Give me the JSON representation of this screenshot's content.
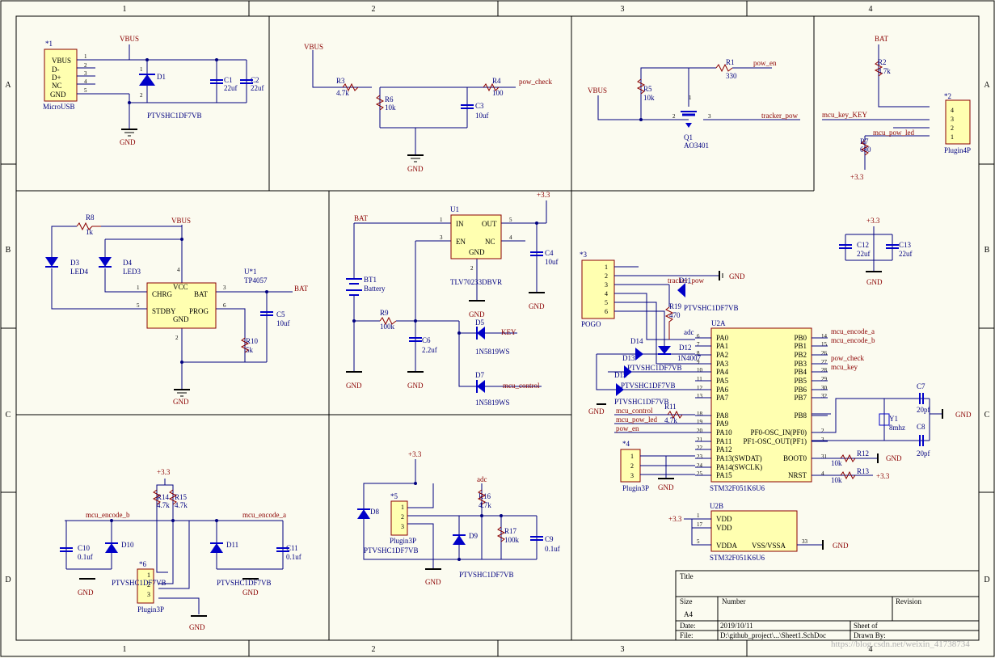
{
  "colors": {
    "bg": "#fbfbf0",
    "wire": "#000080",
    "comp": "#0000c8",
    "body": "#ffffb0",
    "net": "#8b0000",
    "black": "#000000"
  },
  "frame": {
    "cols": [
      "1",
      "2",
      "3",
      "4"
    ],
    "rows": [
      "A",
      "B",
      "C",
      "D"
    ]
  },
  "title_block": {
    "title_label": "Title",
    "size_label": "Size",
    "size_value": "A4",
    "number_label": "Number",
    "revision_label": "Revision",
    "date_label": "Date:",
    "date_value": "2019/10/11",
    "sheet_label": "Sheet    of",
    "file_label": "File:",
    "file_value": "D:\\github_project\\...\\Sheet1.SchDoc",
    "drawn_label": "Drawn By:",
    "watermark": "https://blog.csdn.net/weixin_41738734"
  },
  "usb": {
    "ref": "*1",
    "name": "MicroUSB",
    "pins": [
      "VBUS",
      "D-",
      "D+",
      "NC",
      "GND"
    ],
    "pin_nums": [
      "1",
      "2",
      "3",
      "4",
      "5"
    ],
    "vbus": "VBUS",
    "gnd": "GND",
    "d1": "D1",
    "d1_part": "PTVSHC1DF7VB",
    "c1": "C1",
    "c1v": "22uf",
    "c2": "C2",
    "c2v": "22uf",
    "pin1": "1",
    "pin2": "2"
  },
  "divider": {
    "vbus": "VBUS",
    "r3": "R3",
    "r3v": "4.7k",
    "r6": "R6",
    "r6v": "10k",
    "r4": "R4",
    "r4v": "100",
    "net": "pow_check",
    "c3": "C3",
    "c3v": "10uf",
    "gnd": "GND"
  },
  "mosfet": {
    "r1": "R1",
    "r1v": "330",
    "net_en": "pow_en",
    "vbus": "VBUS",
    "r5": "R5",
    "r5v": "10k",
    "q1": "Q1",
    "q1_part": "AO3401",
    "net_out": "tracker_pow",
    "p1": "1",
    "p2": "2",
    "p3": "3"
  },
  "plugin4": {
    "ref": "*2",
    "name": "Plugin4P",
    "bat": "BAT",
    "r2": "R2",
    "r2v": "4.7k",
    "r7": "R7",
    "r7v": "680",
    "net_key": "mcu_key_KEY",
    "net_led": "mcu_pow_led",
    "p33": "+3.3",
    "pins": [
      "4",
      "3",
      "2",
      "1"
    ]
  },
  "charger": {
    "r8": "R8",
    "r8v": "1k",
    "vbus": "VBUS",
    "d3": "D3",
    "d3n": "LED4",
    "d4": "D4",
    "d4n": "LED3",
    "u1": "U*1",
    "u1_part": "TP4057",
    "pin_vcc": "VCC",
    "pin_chrg": "CHRG",
    "pin_bat": "BAT",
    "pin_stdby": "STDBY",
    "pin_prog": "PROG",
    "pin_gnd": "GND",
    "bat": "BAT",
    "c5": "C5",
    "c5v": "10uf",
    "r10": "R10",
    "r10v": "5k",
    "gnd": "GND",
    "n1": "1",
    "n2": "2",
    "n3": "3",
    "n4": "4",
    "n5": "5",
    "n6": "6"
  },
  "ldo": {
    "bat": "BAT",
    "u1": "U1",
    "part": "TLV70233DBVR",
    "pin_in": "IN",
    "pin_out": "OUT",
    "pin_en": "EN",
    "pin_nc": "NC",
    "pin_gnd": "GND",
    "p33": "+3.3",
    "c4": "C4",
    "c4v": "10uf",
    "bt1": "BT1",
    "bt1n": "Battery",
    "r9": "R9",
    "r9v": "100k",
    "c6": "C6",
    "c6v": "2.2uf",
    "d5": "D5",
    "d5p": "1N5819WS",
    "d7": "D7",
    "d7p": "1N5819WS",
    "net_key": "KEY",
    "net_ctrl": "mcu_control",
    "gnd": "GND",
    "n1": "1",
    "n2": "2",
    "n3": "3",
    "n4": "4",
    "n5": "5"
  },
  "pogo": {
    "ref": "*3",
    "name": "POGO",
    "pins": [
      "1",
      "2",
      "3",
      "4",
      "5",
      "6"
    ],
    "net_tracker": "tracker_pow",
    "d11": "D11",
    "d11p": "PTVSHC1DF7VB",
    "gnd": "GND",
    "r19": "R19",
    "r19v": "470",
    "d12": "D12",
    "d12p": "1N4007",
    "d14": "D14",
    "d13": "D13",
    "d15": "D15",
    "d1x": "PTVSHC1DF7VB"
  },
  "mcu": {
    "ref": "U2A",
    "part": "STM32F051K6U6",
    "left_pins": [
      "PA0",
      "PA1",
      "PA2",
      "PA3",
      "PA4",
      "PA5",
      "PA6",
      "PA7",
      "PA8",
      "PA9",
      "PA10",
      "PA11",
      "PA12",
      "PA13(SWDAT)",
      "PA14(SWCLK)",
      "PA15"
    ],
    "left_nums": [
      "6",
      "7",
      "8",
      "9",
      "10",
      "11",
      "12",
      "13",
      "18",
      "19",
      "20",
      "21",
      "22",
      "23",
      "24",
      "25"
    ],
    "right_pins": [
      "PB0",
      "PB1",
      "PB2",
      "PB3",
      "PB4",
      "PB5",
      "PB6",
      "PB7",
      "PB8",
      "PF0-OSC_IN(PF0)",
      "PF1-OSC_OUT(PF1)",
      "BOOT0",
      "NRST"
    ],
    "right_nums": [
      "14",
      "15",
      "26",
      "27",
      "28",
      "29",
      "30",
      "32",
      "",
      "2",
      "3",
      "31",
      "4"
    ],
    "net_adc": "adc",
    "net_ctrl": "mcu_control",
    "net_led": "mcu_pow_led",
    "net_en": "pow_en",
    "net_enc_a": "mcu_encode_a",
    "net_enc_b": "mcu_encode_b",
    "net_check": "pow_check",
    "net_key": "mcu_key",
    "r11": "R11",
    "r11v": "4.7k",
    "y1": "Y1",
    "y1v": "8mhz",
    "c7": "C7",
    "c7v": "20pf",
    "c8": "C8",
    "c8v": "20pf",
    "r12": "R12",
    "r12v": "10k",
    "r13": "R13",
    "r13v": "10k",
    "p33": "+3.3",
    "gnd": "GND"
  },
  "plugin3_mid": {
    "ref": "*4",
    "name": "Plugin3P",
    "gnd": "GND",
    "pins": [
      "1",
      "2",
      "3"
    ]
  },
  "mcu_b": {
    "ref": "U2B",
    "part": "STM32F051K6U6",
    "vdd": "VDD",
    "vdda": "VDDA",
    "vss": "VSS/VSSA",
    "p33": "+3.3",
    "gnd": "GND",
    "n1": "1",
    "n17": "17",
    "n5": "5",
    "n33": "33"
  },
  "caps_b": {
    "p33": "+3.3",
    "c12": "C12",
    "c12v": "22uf",
    "c13": "C13",
    "c13v": "22uf",
    "gnd": "GND"
  },
  "encoder": {
    "p33": "+3.3",
    "r14": "R14",
    "r14v": "4.7k",
    "r15": "R15",
    "r15v": "4.7k",
    "net_b": "mcu_encode_b",
    "net_a": "mcu_encode_a",
    "c10": "C10",
    "c10v": "0.1uf",
    "c11": "C11",
    "c11v": "0.1uf",
    "d10": "D10",
    "d10p": "PTVSHC1DF7VB",
    "d11": "D11",
    "d11p": "PTVSHC1DF7VB",
    "ref": "*6",
    "name": "Plugin3P",
    "gnd": "GND",
    "pins": [
      "1",
      "2",
      "3"
    ]
  },
  "adcblock": {
    "p33": "+3.3",
    "ref": "*5",
    "name": "Plugin3P",
    "d8": "D8",
    "d8p": "PTVSHC1DF7VB",
    "adc": "adc",
    "r16": "R16",
    "r16v": "4.7k",
    "r17": "R17",
    "r17v": "100k",
    "c9": "C9",
    "c9v": "0.1uf",
    "d9": "D9",
    "d9p": "PTVSHC1DF7VB",
    "gnd": "GND",
    "pins": [
      "1",
      "2",
      "3"
    ]
  }
}
